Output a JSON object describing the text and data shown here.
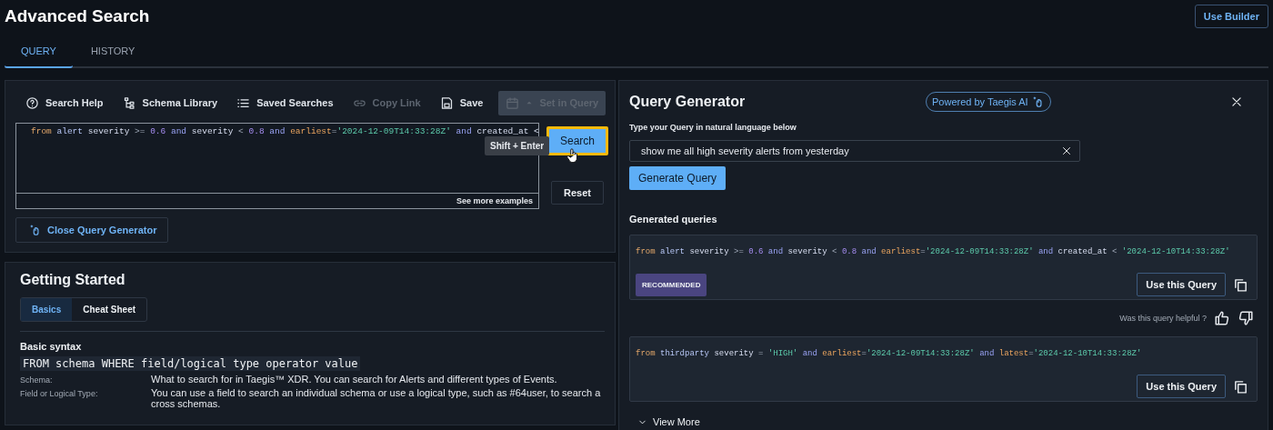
{
  "page": {
    "title": "Advanced Search",
    "action": "Use Builder"
  },
  "tabs": [
    {
      "label": "QUERY",
      "selected": true
    },
    {
      "label": "HISTORY",
      "selected": false
    }
  ],
  "query_panel": {
    "toolbar": [
      {
        "label": "Search Help",
        "kind": "action",
        "disabled": false
      },
      {
        "label": "Schema Library",
        "kind": "action",
        "disabled": false
      },
      {
        "label": "Saved Searches",
        "kind": "action",
        "disabled": false
      },
      {
        "label": "Copy Link",
        "kind": "action",
        "disabled": true
      },
      {
        "label": "Save",
        "kind": "action",
        "disabled": false
      },
      {
        "label": "Set in Query",
        "kind": "dropdown",
        "disabled": true
      }
    ],
    "editor": {
      "tokens": [
        {
          "text": "from ",
          "kind": "keyword"
        },
        {
          "text": "alert ",
          "kind": "schema"
        },
        {
          "text": "severity ",
          "kind": "field"
        },
        {
          "text": ">= ",
          "kind": "operator"
        },
        {
          "text": "0.6 ",
          "kind": "number"
        },
        {
          "text": "and ",
          "kind": "logic"
        },
        {
          "text": "severity ",
          "kind": "field"
        },
        {
          "text": "< ",
          "kind": "operator"
        },
        {
          "text": "0.8 ",
          "kind": "number"
        },
        {
          "text": "and ",
          "kind": "logic"
        },
        {
          "text": "earliest",
          "kind": "timefield"
        },
        {
          "text": "=",
          "kind": "operator"
        },
        {
          "text": "'2024-12-09T14:33:28Z' ",
          "kind": "string"
        },
        {
          "text": "and ",
          "kind": "logic"
        },
        {
          "text": "created_at <",
          "kind": "field"
        }
      ],
      "footer_link": "See more examples"
    },
    "tooltip": "Shift + Enter",
    "search_button": "Search",
    "reset_button": "Reset",
    "close_button": "Close Query Generator"
  },
  "getting_started": {
    "title": "Getting Started",
    "tabs": [
      {
        "label": "Basics",
        "selected": true
      },
      {
        "label": "Cheat Sheet",
        "selected": false
      }
    ],
    "section_title": "Basic syntax",
    "syntax": "FROM schema WHERE field/logical type operator value",
    "definitions": [
      {
        "term": "Schema:",
        "description": "What to search for in Taegis™ XDR. You can search for Alerts and different types of Events."
      },
      {
        "term": "Field or Logical Type:",
        "description": "You can use a field to search an individual schema or use a logical type, such as #64user, to search across schemas."
      }
    ]
  },
  "query_generator": {
    "title": "Query Generator",
    "badge": "Powered by Taegis AI",
    "prompt_label": "Type your Query in natural language below",
    "input_value": "show me all high severity alerts from yesterday",
    "generate_button": "Generate Query",
    "generated_title": "Generated queries",
    "queries": [
      {
        "tokens": [
          {
            "text": "from ",
            "kind": "keyword"
          },
          {
            "text": "alert ",
            "kind": "schema"
          },
          {
            "text": "severity ",
            "kind": "field"
          },
          {
            "text": ">= ",
            "kind": "operator"
          },
          {
            "text": "0.6 ",
            "kind": "number"
          },
          {
            "text": "and ",
            "kind": "logic"
          },
          {
            "text": "severity ",
            "kind": "field"
          },
          {
            "text": "< ",
            "kind": "operator"
          },
          {
            "text": "0.8 ",
            "kind": "number"
          },
          {
            "text": "and ",
            "kind": "logic"
          },
          {
            "text": "earliest",
            "kind": "timefield"
          },
          {
            "text": "=",
            "kind": "operator"
          },
          {
            "text": "'2024-12-09T14:33:28Z' ",
            "kind": "string"
          },
          {
            "text": "and ",
            "kind": "logic"
          },
          {
            "text": "created_at ",
            "kind": "field"
          },
          {
            "text": "< ",
            "kind": "operator"
          },
          {
            "text": "'2024-12-10T14:33:28Z'",
            "kind": "string"
          }
        ],
        "badge": "RECOMMENDED",
        "button": "Use this Query"
      },
      {
        "tokens": [
          {
            "text": "from ",
            "kind": "keyword"
          },
          {
            "text": "thirdparty ",
            "kind": "schema"
          },
          {
            "text": "severity ",
            "kind": "field"
          },
          {
            "text": "= ",
            "kind": "operator"
          },
          {
            "text": "'HIGH' ",
            "kind": "string"
          },
          {
            "text": "and ",
            "kind": "logic"
          },
          {
            "text": "earliest",
            "kind": "timefield"
          },
          {
            "text": "=",
            "kind": "operator"
          },
          {
            "text": "'2024-12-09T14:33:28Z' ",
            "kind": "string"
          },
          {
            "text": "and ",
            "kind": "logic"
          },
          {
            "text": "latest",
            "kind": "timefield"
          },
          {
            "text": "=",
            "kind": "operator"
          },
          {
            "text": "'2024-12-10T14:33:28Z'",
            "kind": "string"
          }
        ],
        "button": "Use this Query"
      }
    ],
    "feedback": "Was this query helpful ?",
    "view_more": "View More"
  }
}
